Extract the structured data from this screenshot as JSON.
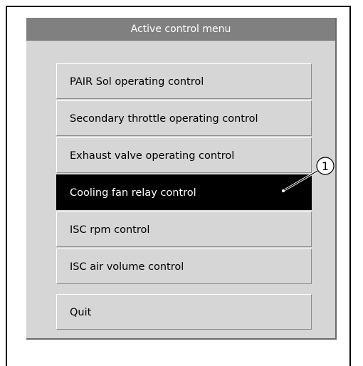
{
  "window": {
    "title": "Active control menu"
  },
  "menu": {
    "items": [
      {
        "label": "PAIR Sol operating control",
        "selected": false
      },
      {
        "label": "Secondary throttle operating control",
        "selected": false
      },
      {
        "label": "Exhaust valve operating control",
        "selected": false
      },
      {
        "label": "Cooling fan relay control",
        "selected": true
      },
      {
        "label": "ISC rpm control",
        "selected": false
      },
      {
        "label": "ISC air volume control",
        "selected": false
      }
    ],
    "quit_label": "Quit"
  },
  "callout": {
    "label": "①"
  },
  "colors": {
    "window_bg": "#d6d6d6",
    "title_bar": "#808080",
    "selected_bg": "#000000",
    "selected_text": "#ffffff"
  }
}
